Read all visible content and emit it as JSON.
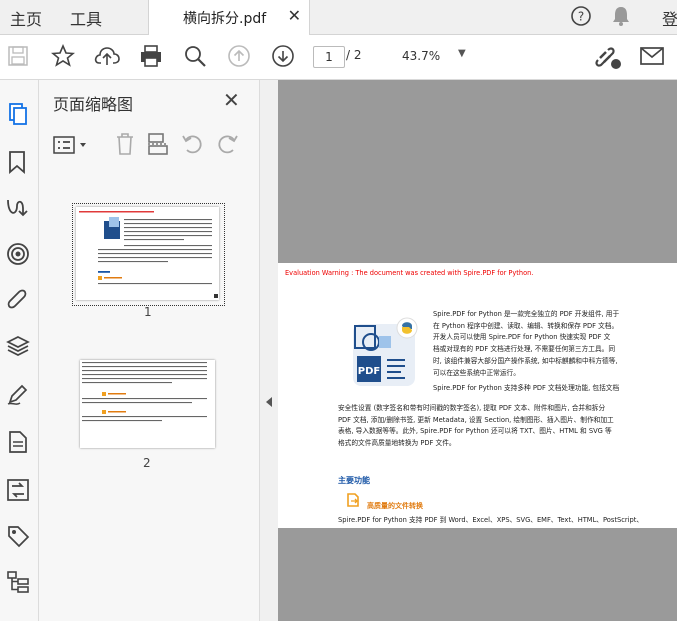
{
  "menubar": {
    "home_label": "主页",
    "tools_label": "工具",
    "signin_label": "登"
  },
  "tab": {
    "title": "横向拆分.pdf",
    "close_glyph": "✕"
  },
  "toolbar": {
    "current_page": "1",
    "total_pages": "/ 2",
    "zoom": "43.7%"
  },
  "panel": {
    "title": "页面缩略图",
    "thumbnails": [
      {
        "label": "1"
      },
      {
        "label": "2"
      }
    ]
  },
  "document": {
    "warning": "Evaluation Warning : The document was created with Spire.PDF for Python.",
    "intro_lines": [
      "Spire.PDF for Python 是一款完全独立的 PDF 开发组件, 用于",
      "在 Python 程序中创建、读取、编辑、转换和保存 PDF 文档。",
      "开发人员可以使用 Spire.PDF for Python 快速实现 PDF 文",
      "档或对现有的 PDF 文档进行处理, 不需要任何第三方工具。同",
      "时, 该组件兼容大部分国产操作系统, 如中标麒麟和中科方德等,",
      "可以在这些系统中正常运行。"
    ],
    "para2_first": "Spire.PDF for Python 支持多种 PDF 文档处理功能, 包括文档",
    "para2_lines": [
      "安全性设置 (数字签名和带有时间戳的数字签名), 提取 PDF 文本、附件和图片, 合并和拆分",
      "PDF 文档, 添加/删除书签, 更新 Metadata, 设置 Section, 绘制图形、插入图片、制作和加工",
      "表格, 导入数据等等。此外, Spire.PDF for Python 还可以将 TXT、图片、HTML 和 SVG 等",
      "格式的文件高质量地转换为 PDF 文件。"
    ],
    "section_heading": "主要功能",
    "sub_heading": "高质量的文件转换",
    "last_line": "Spire.PDF for Python 支持 PDF 到 Word、Excel、XPS、SVG、EMF、Text、HTML、PostScript、",
    "logo_text": "PDF"
  }
}
